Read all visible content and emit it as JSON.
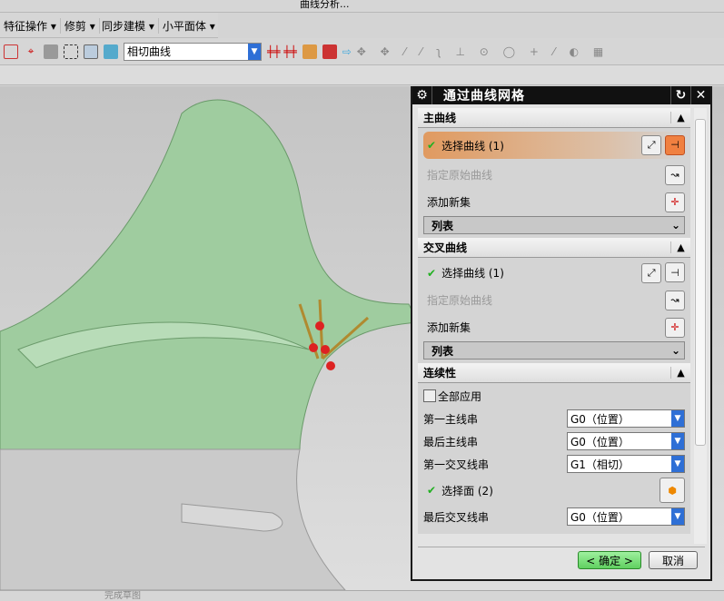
{
  "toolbar_top": {
    "curve_analysis": "曲线分析..."
  },
  "menu": [
    "特征操作",
    "修剪",
    "同步建模",
    "小平面体"
  ],
  "selection_filter": {
    "value": "相切曲线"
  },
  "dialog": {
    "title": "通过曲线网格",
    "primary": {
      "header": "主曲线",
      "select": "选择曲线 (1)",
      "specify": "指定原始曲线",
      "add": "添加新集",
      "list": "列表"
    },
    "cross": {
      "header": "交叉曲线",
      "select": "选择曲线 (1)",
      "specify": "指定原始曲线",
      "add": "添加新集",
      "list": "列表"
    },
    "continuity": {
      "header": "连续性",
      "apply_all": "全部应用",
      "rows": [
        {
          "label": "第一主线串",
          "value": "G0（位置）"
        },
        {
          "label": "最后主线串",
          "value": "G0（位置）"
        },
        {
          "label": "第一交叉线串",
          "value": "G1（相切）"
        }
      ],
      "select_face": "选择面 (2)",
      "last_cross": {
        "label": "最后交叉线串",
        "value": "G0（位置）"
      }
    },
    "ok": "< 确定 >",
    "cancel": "取消"
  },
  "status": {
    "finish_sketch": "完成草图"
  }
}
